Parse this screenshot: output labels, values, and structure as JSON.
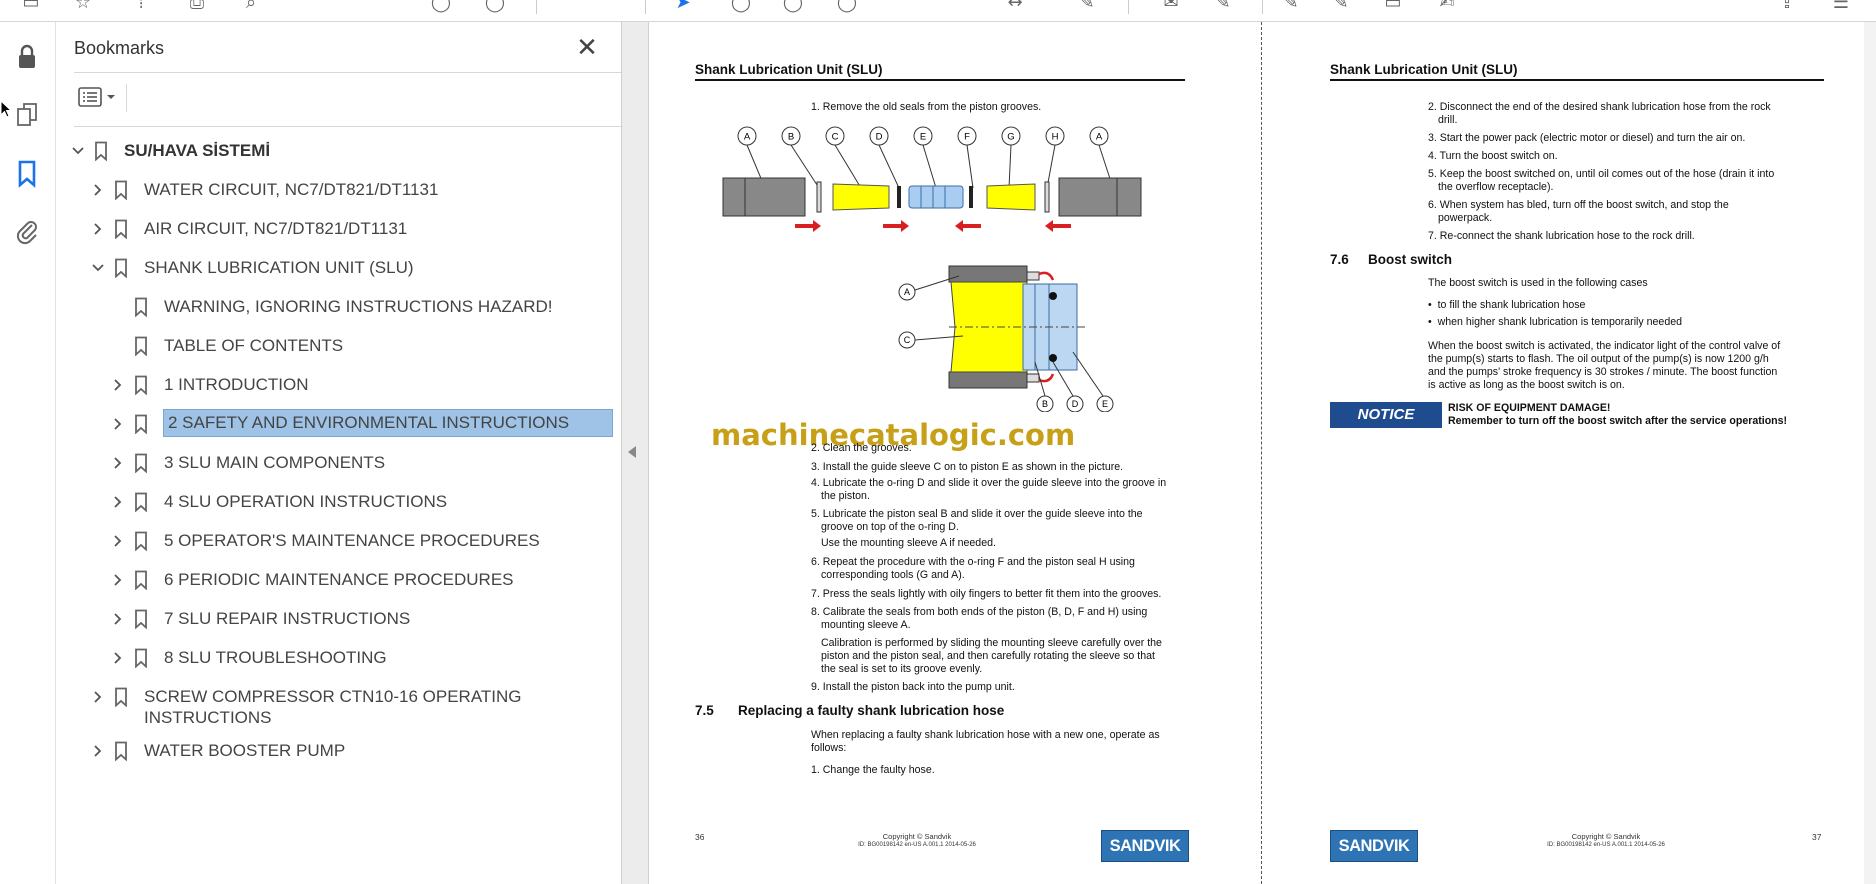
{
  "panel": {
    "title": "Bookmarks",
    "items": [
      {
        "label": "SU/HAVA SİSTEMİ"
      },
      {
        "label": "WATER CIRCUIT, NC7/DT821/DT1131"
      },
      {
        "label": "AIR CIRCUIT, NC7/DT821/DT1131"
      },
      {
        "label": "SHANK LUBRICATION UNIT (SLU)"
      },
      {
        "label": "WARNING, IGNORING INSTRUCTIONS HAZARD!"
      },
      {
        "label": "TABLE OF CONTENTS"
      },
      {
        "label": "1 INTRODUCTION"
      },
      {
        "label": "2 SAFETY AND ENVIRONMENTAL INSTRUCTIONS"
      },
      {
        "label": "3 SLU MAIN COMPONENTS"
      },
      {
        "label": "4 SLU OPERATION INSTRUCTIONS"
      },
      {
        "label": "5 OPERATOR'S MAINTENANCE PROCEDURES"
      },
      {
        "label": "6 PERIODIC MAINTENANCE PROCEDURES"
      },
      {
        "label": "7 SLU REPAIR INSTRUCTIONS"
      },
      {
        "label": "8 SLU TROUBLESHOOTING"
      },
      {
        "label1": "SCREW COMPRESSOR CTN10-16  OPERATING",
        "label2": "INSTRUCTIONS"
      },
      {
        "label": "WATER BOOSTER PUMP"
      }
    ]
  },
  "page36": {
    "header": "Shank Lubrication Unit (SLU)",
    "step1": "1. Remove the old seals from the piston grooves.",
    "fig1_letters": [
      "A",
      "B",
      "C",
      "D",
      "E",
      "F",
      "G",
      "H",
      "A"
    ],
    "fig2_letters": {
      "a": "A",
      "c": "C",
      "b": "B",
      "d": "D",
      "e": "E"
    },
    "watermark": "machinecatalogic.com",
    "steps": [
      "2. Clean the grooves.",
      "3. Install the guide sleeve C on to piston E as shown in the picture.",
      "4. Lubricate the o-ring D and slide it over the guide sleeve into the groove in",
      "the piston.",
      "5. Lubricate the piston seal B and slide it over the guide sleeve into the",
      "groove on top of the o-ring D.",
      "Use the mounting sleeve A if needed.",
      "6. Repeat the procedure with the o-ring F and the piston seal H using",
      "corresponding tools (G and A).",
      "7. Press the seals lightly with oily fingers to better fit them into the grooves.",
      "8. Calibrate the seals from both ends of the piston (B, D, F and H) using",
      "mounting sleeve A.",
      "Calibration is performed by sliding the mounting sleeve carefully over the",
      "piston and the piston seal, and then carefully rotating the sleeve so that",
      "the seal is set to its groove evenly.",
      "9. Install the piston back into the pump unit."
    ],
    "sec_num": "7.5",
    "sec_title": "Replacing a faulty shank lubrication hose",
    "intro1": "When replacing a faulty shank lubrication hose with a new one, operate as",
    "intro2": "follows:",
    "step_b1": "1. Change the faulty hose.",
    "page_no": "36",
    "copyright": "Copyright © Sandvik",
    "docid": "ID: BG00198142 en-US A.001.1 2014-05-26",
    "logo": "SANDVIK"
  },
  "page37": {
    "header": "Shank Lubrication Unit (SLU)",
    "lines": [
      "2. Disconnect the end of the desired shank lubrication hose from the rock",
      "drill.",
      "3. Start the power pack (electric motor or diesel) and turn the air on.",
      "4. Turn the boost switch on.",
      "5. Keep the boost switched on, until oil comes out of the hose (drain it into",
      "the overflow receptacle).",
      "6. When system has bled, turn off the boost switch, and stop the",
      "powerpack.",
      "7. Re-connect the shank lubrication hose to the rock drill."
    ],
    "sec_num": "7.6",
    "sec_title": "Boost switch",
    "intro": "The boost switch is used in the following cases",
    "bullets": [
      "to fill the shank lubrication hose",
      "when higher shank lubrication is temporarily needed"
    ],
    "para": [
      "When the boost switch is activated, the indicator light of the control valve of",
      "the pump(s) starts to flash. The oil output of the pump(s) is now 1200 g/h",
      "and the pumps' stroke frequency is 30 strokes / minute. The boost function",
      "is active as long as the boost switch is on."
    ],
    "notice": "NOTICE",
    "notice_l1": "RISK OF EQUIPMENT DAMAGE!",
    "notice_l2": "Remember to turn off the boost switch after the service operations!",
    "page_no": "37",
    "copyright": "Copyright © Sandvik",
    "docid": "ID: BG00198142 en-US A.001.1 2014-05-26",
    "logo": "SANDVIK"
  },
  "colors": {
    "selection": "#9ec3e6",
    "accent": "#1a73e8",
    "notice": "#1f4c8f",
    "yellow": "#ffff00"
  }
}
